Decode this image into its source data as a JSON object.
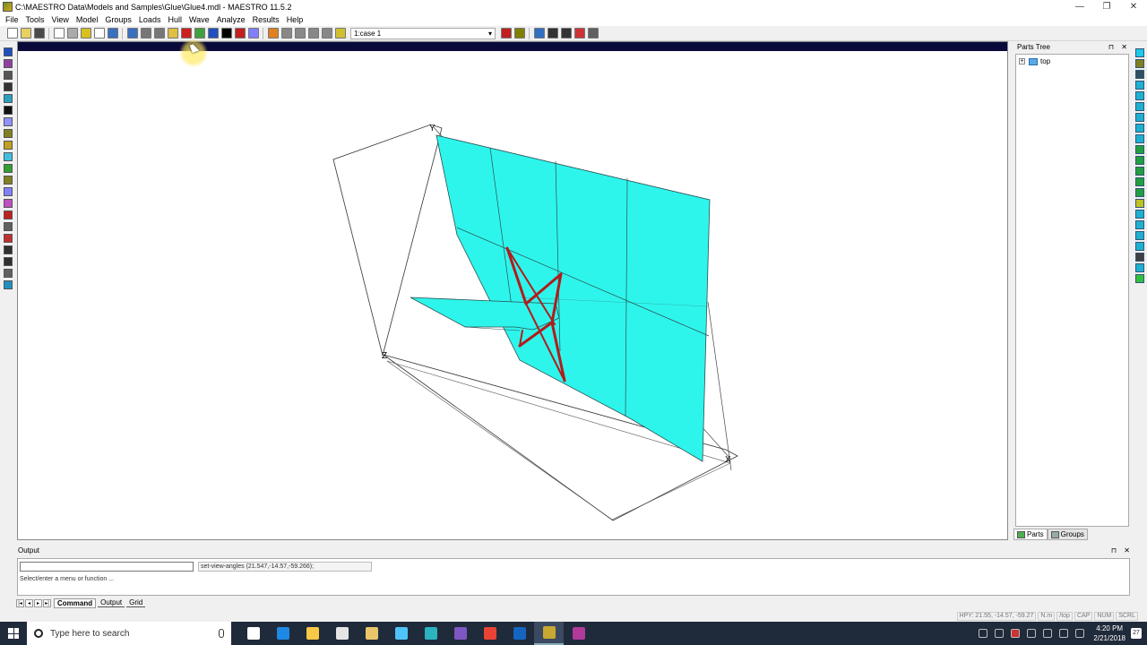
{
  "window": {
    "title": "C:\\MAESTRO Data\\Models and Samples\\Glue\\Glue4.mdl - MAESTRO 11.5.2",
    "minimize": "—",
    "maximize": "❐",
    "close": "✕"
  },
  "menu": [
    "File",
    "Tools",
    "View",
    "Model",
    "Groups",
    "Loads",
    "Hull",
    "Wave",
    "Analyze",
    "Results",
    "Help"
  ],
  "toolbar": {
    "case_value": "1:case 1",
    "left_colors": [
      "#ffffff",
      "#e8d060",
      "#4a4a4a",
      "#ffffff",
      "#aaaaaa",
      "#d8c020",
      "#ffffff",
      "#3a70c0",
      "#3a70c0",
      "#777777",
      "#777777",
      "#e0c040",
      "#cc2020",
      "#40a040",
      "#2050c0",
      "#000000",
      "#c02020",
      "#8080ff",
      "#e08020",
      "#888888",
      "#888888",
      "#888888",
      "#888888",
      "#d0c030"
    ],
    "right_colors": [
      "#c02020",
      "#808000",
      "#3070c0",
      "#333333",
      "#333333",
      "#cc3333",
      "#606060"
    ]
  },
  "left_tools": [
    "#2050c0",
    "#9040a0",
    "#555555",
    "#333333",
    "#2aa0c0",
    "#101010",
    "#9090ff",
    "#808020",
    "#c0a020",
    "#40c0e0",
    "#30a030",
    "#808020",
    "#8080ff",
    "#c050c0",
    "#c02020",
    "#606060",
    "#c03030",
    "#303030",
    "#303030",
    "#606060",
    "#2090c0"
  ],
  "right_tools": [
    "#1ec8e8",
    "#808020",
    "#305060",
    "#1eb0d0",
    "#1eb0d0",
    "#1eb0d0",
    "#1eb0d0",
    "#1eb0d0",
    "#1eb0d0",
    "#20a040",
    "#20a040",
    "#20a040",
    "#20a040",
    "#20a040",
    "#c0c020",
    "#1eb0d0",
    "#1eb0d0",
    "#1eb0d0",
    "#1eb0d0",
    "#404040",
    "#1eb0d0",
    "#30c040"
  ],
  "viewport": {
    "axis_labels": {
      "x": "X",
      "y": "Y",
      "z": "Z"
    },
    "panel_color": "#2ef5ec",
    "member_color": "#b11c1c"
  },
  "parts_tree": {
    "title": "Parts Tree",
    "pin": "⊓",
    "close": "✕",
    "root_item": "top",
    "expander": "+",
    "tabs": [
      "Parts",
      "Groups"
    ]
  },
  "output": {
    "title": "Output",
    "last_command": "set-view-angles (21.547,-14.57,-59.266);",
    "prompt": "Select/enter a menu or function ...",
    "tabs": [
      "Command",
      "Output",
      "Grid"
    ],
    "nav": [
      "|◂",
      "◂",
      "▸",
      "▸|"
    ]
  },
  "statusbar": [
    "HPY: 21.55, -14.57, -59.27",
    "N.m",
    "/top",
    "CAP",
    "NUM",
    "SCRL"
  ],
  "taskbar": {
    "search_placeholder": "Type here to search",
    "apps": [
      "#ffffff",
      "#1e88e5",
      "#f9c846",
      "#e5e5e5",
      "#e9c46a",
      "#4fc3f7",
      "#2bb3c0",
      "#7e57c2",
      "#ea4335",
      "#1565c0",
      "#c8a830",
      "#b03a9a"
    ],
    "time": "4:20 PM",
    "date": "2/21/2018",
    "notification_count": "27"
  }
}
